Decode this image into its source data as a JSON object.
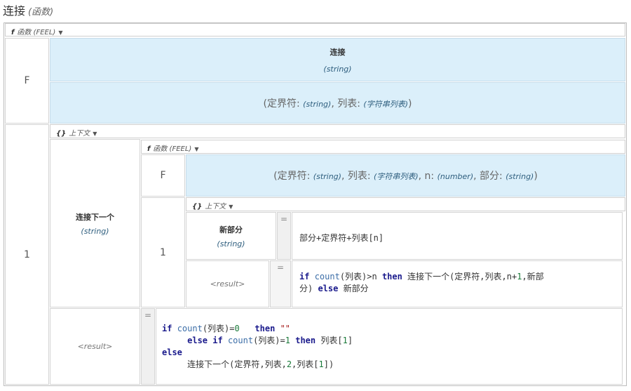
{
  "title": {
    "name": "连接",
    "kind": "(函数)"
  },
  "outer_fn": {
    "kind_letter": "f",
    "kind_label": "函数 (FEEL)",
    "header_letter": "F",
    "name": "连接",
    "return_type": "(string)",
    "signature": {
      "p1": "定界符",
      "p1_type": "(string)",
      "p2": "列表",
      "p2_type": "(字符串列表)"
    },
    "row_index": "1"
  },
  "context": {
    "icon": "{}",
    "label": "上下文",
    "entry_name": "连接下一个",
    "entry_type": "(string)",
    "result_label": "<result>"
  },
  "inner_fn": {
    "kind_letter": "f",
    "kind_label": "函数 (FEEL)",
    "header_letter": "F",
    "signature": {
      "p1": "定界符",
      "p1_type": "(string)",
      "p2": "列表",
      "p2_type": "(字符串列表)",
      "p3": "n",
      "p3_type": "(number)",
      "p4": "部分",
      "p4_type": "(string)"
    },
    "row_index": "1"
  },
  "inner_context": {
    "icon": "{}",
    "label": "上下文",
    "entry_name": "新部分",
    "entry_type": "(string)",
    "result_label": "<result>",
    "eq": "="
  },
  "expressions": {
    "new_part": "部分+定界符+列表[n]",
    "inner_result": {
      "if": "if",
      "count": "count",
      "a1": "(列表)>n ",
      "then": "then",
      "a2": " 连接下一个(定界符,列表,n+",
      "one": "1",
      "a3": ",新部",
      "a4": "分) ",
      "else": "else",
      "a5": " 新部分"
    },
    "outer_result": {
      "if": "if",
      "count": "count",
      "a1": "(列表)=",
      "zero": "0",
      "then": "then",
      "quote": "\"\"",
      "else": "else",
      "if2": "if",
      "count2": "count",
      "a2": "(列表)=",
      "one": "1",
      "then2": "then",
      "a3": " 列表[",
      "one2": "1",
      "a4": "]",
      "else2": "else",
      "a5": "连接下一个(定界符,列表,",
      "two": "2",
      "a6": ",列表[",
      "one3": "1",
      "a7": "])"
    }
  }
}
